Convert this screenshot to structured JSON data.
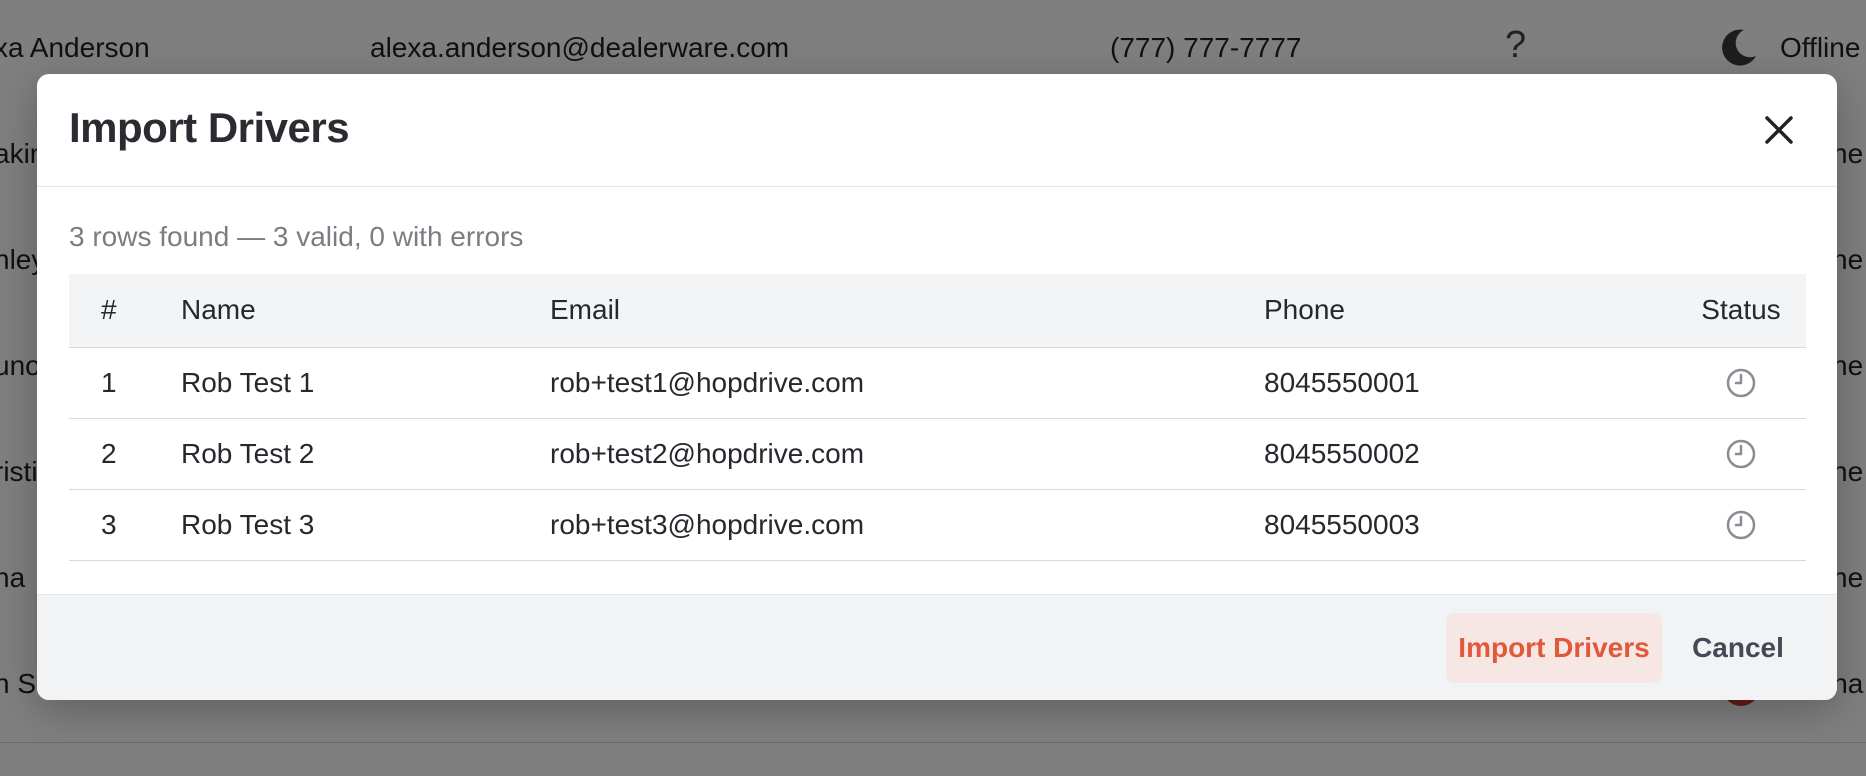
{
  "background": {
    "rows": [
      {
        "name": "xa Anderson",
        "email": "alexa.anderson@dealerware.com",
        "phone": "(777) 777-7777",
        "badge": "?",
        "status": "Offline",
        "status_icon": "moon-icon"
      },
      {
        "name": "akin",
        "status": "ne"
      },
      {
        "name": "nley",
        "status": "ne"
      },
      {
        "name": "uno",
        "status": "ne"
      },
      {
        "name": "risti",
        "status": "ne"
      },
      {
        "name": "na",
        "status": "ne"
      },
      {
        "name": "n Sc",
        "status": "ina"
      }
    ]
  },
  "modal": {
    "title": "Import Drivers",
    "summary": "3 rows found — 3 valid, 0 with errors",
    "table": {
      "headers": [
        "#",
        "Name",
        "Email",
        "Phone",
        "Status"
      ],
      "rows": [
        {
          "num": "1",
          "name": "Rob Test 1",
          "email": "rob+test1@hopdrive.com",
          "phone": "8045550001",
          "status_icon": "clock-icon"
        },
        {
          "num": "2",
          "name": "Rob Test 2",
          "email": "rob+test2@hopdrive.com",
          "phone": "8045550002",
          "status_icon": "clock-icon"
        },
        {
          "num": "3",
          "name": "Rob Test 3",
          "email": "rob+test3@hopdrive.com",
          "phone": "8045550003",
          "status_icon": "clock-icon"
        }
      ]
    },
    "footer": {
      "import_label": "Import Drivers",
      "cancel_label": "Cancel"
    }
  },
  "colors": {
    "accent": "#e2583a",
    "accent_bg": "#f7e7e4",
    "header_bg": "#f2f4f5",
    "footer_bg": "#f1f3f4"
  }
}
